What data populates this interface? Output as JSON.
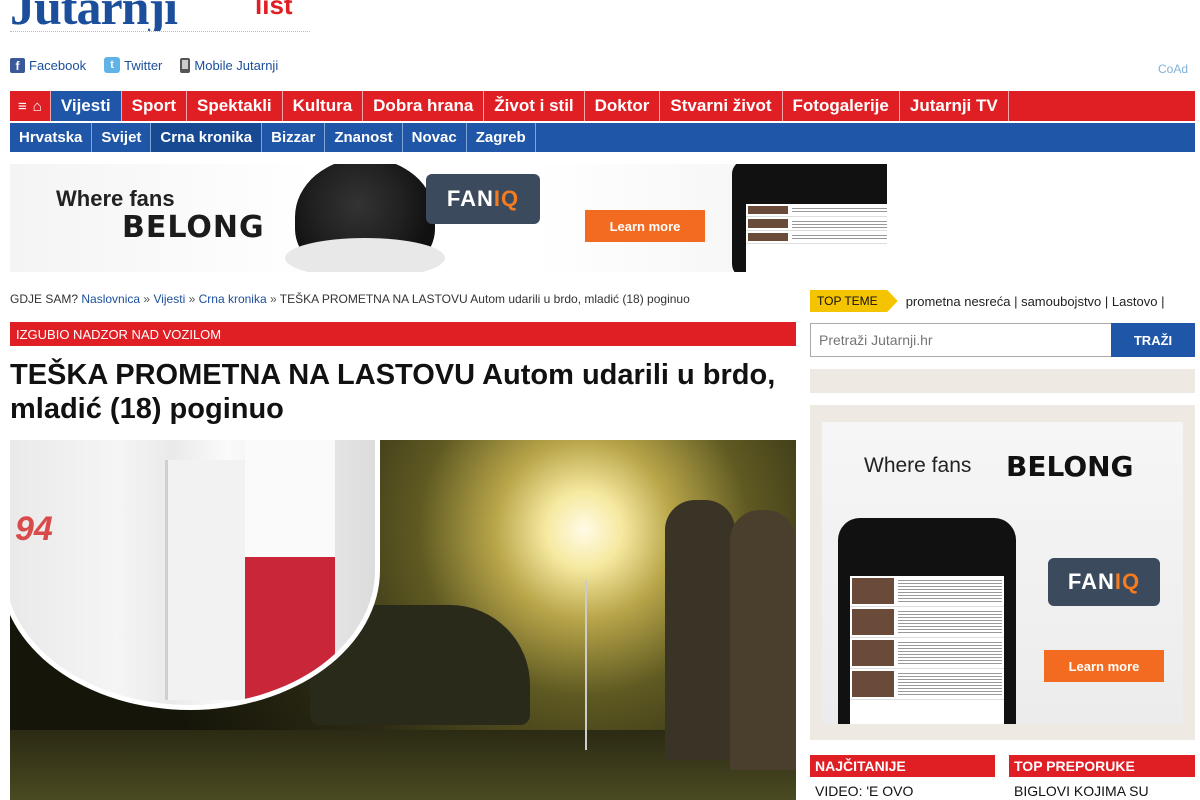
{
  "brand": {
    "logo_main": "Jutarnji",
    "logo_sub": "list"
  },
  "social": {
    "facebook": "Facebook",
    "twitter": "Twitter",
    "mobile": "Mobile Jutarnji"
  },
  "coad": "CoAd",
  "nav_main": [
    {
      "label": "Vijesti",
      "active": true
    },
    {
      "label": "Sport"
    },
    {
      "label": "Spektakli"
    },
    {
      "label": "Kultura"
    },
    {
      "label": "Dobra hrana"
    },
    {
      "label": "Život i stil"
    },
    {
      "label": "Doktor"
    },
    {
      "label": "Stvarni život"
    },
    {
      "label": "Fotogalerije"
    },
    {
      "label": "Jutarnji TV"
    }
  ],
  "nav_sub": [
    {
      "label": "Hrvatska"
    },
    {
      "label": "Svijet"
    },
    {
      "label": "Crna kronika",
      "active": true
    },
    {
      "label": "Bizzar"
    },
    {
      "label": "Znanost"
    },
    {
      "label": "Novac"
    },
    {
      "label": "Zagreb"
    }
  ],
  "ad_top": {
    "line1": "Where fans",
    "line2": "BELONG",
    "brand_a": "FAN",
    "brand_b": "IQ",
    "cta": "Learn more"
  },
  "breadcrumb": {
    "prefix": "GDJE SAM?",
    "items": [
      "Naslovnica",
      "Vijesti",
      "Crna kronika"
    ],
    "current": "TEŠKA PROMETNA NA LASTOVU Autom udarili u brdo, mladić (18) poginuo"
  },
  "article": {
    "kicker": "IZGUBIO NADZOR NAD VOZILOM",
    "title": "TEŠKA PROMETNA NA LASTOVU Autom udarili u brdo, mladić (18) poginuo",
    "photo_ambulance_number": "94"
  },
  "top_teme": {
    "label": "TOP TEME",
    "links": [
      "prometna nesreća",
      "samoubojstvo",
      "Lastovo"
    ]
  },
  "search": {
    "placeholder": "Pretraži Jutarnji.hr",
    "button": "TRAŽI"
  },
  "ad_side": {
    "line1": "Where fans",
    "line2": "BELONG",
    "brand_a": "FAN",
    "brand_b": "IQ",
    "cta": "Learn more"
  },
  "boxes": {
    "most_read": {
      "title": "NAJČITANIJE",
      "first": "VIDEO: 'E OVO"
    },
    "top_recommend": {
      "title": "TOP PREPORUKE",
      "first": "BIGLOVI KOJIMA SU"
    }
  },
  "colors": {
    "brand_red": "#e01f25",
    "brand_blue": "#1f56a8",
    "tag_yellow": "#f5c400",
    "cta_orange": "#f26b21"
  }
}
